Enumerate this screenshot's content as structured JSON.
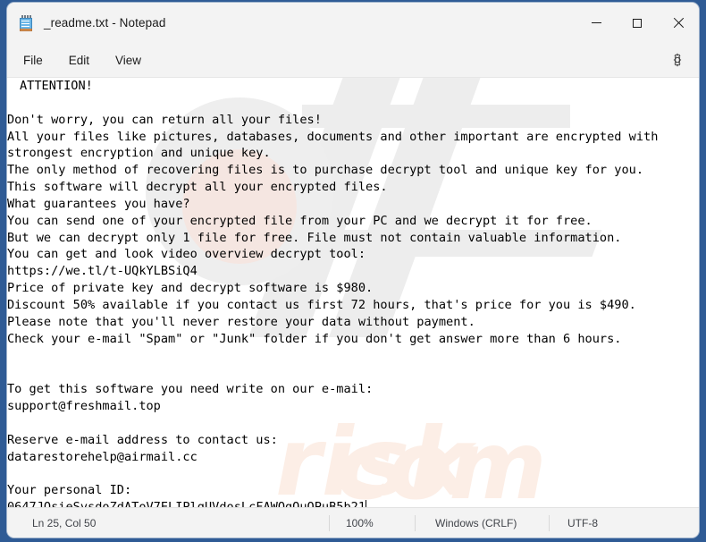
{
  "window": {
    "title": "_readme.txt - Notepad",
    "app_icon": "notepad-icon",
    "controls": {
      "minimize": "minimize-icon",
      "maximize": "maximize-icon",
      "close": "close-icon"
    }
  },
  "menu": {
    "items": [
      {
        "label": "File"
      },
      {
        "label": "Edit"
      },
      {
        "label": "View"
      }
    ],
    "settings_icon": "gear-icon"
  },
  "watermark": {
    "text_com": "com",
    "text_risk": "risk"
  },
  "editor": {
    "content": "ATTENTION!\n\nDon't worry, you can return all your files!\nAll your files like pictures, databases, documents and other important are encrypted with\nstrongest encryption and unique key.\nThe only method of recovering files is to purchase decrypt tool and unique key for you.\nThis software will decrypt all your encrypted files.\nWhat guarantees you have?\nYou can send one of your encrypted file from your PC and we decrypt it for free.\nBut we can decrypt only 1 file for free. File must not contain valuable information.\nYou can get and look video overview decrypt tool:\nhttps://we.tl/t-UQkYLBSiQ4\nPrice of private key and decrypt software is $980.\nDiscount 50% available if you contact us first 72 hours, that's price for you is $490.\nPlease note that you'll never restore your data without payment.\nCheck your e-mail \"Spam\" or \"Junk\" folder if you don't get answer more than 6 hours.\n\n\nTo get this software you need write on our e-mail:\nsupport@freshmail.top\n\nReserve e-mail address to contact us:\ndatarestorehelp@airmail.cc\n\nYour personal ID:\n0647JOsieSvsdoZdAToV7ELIPlgUVdosLcFAWOgQuQPuB5b21"
  },
  "status": {
    "position": "Ln 25, Col 50",
    "zoom": "100%",
    "line_ending": "Windows (CRLF)",
    "encoding": "UTF-8"
  },
  "colors": {
    "desktop": "#2f5b95",
    "window_chrome": "#f3f3f3",
    "editor_background": "#ffffff",
    "text": "#000000",
    "watermark": "#fceee6"
  }
}
